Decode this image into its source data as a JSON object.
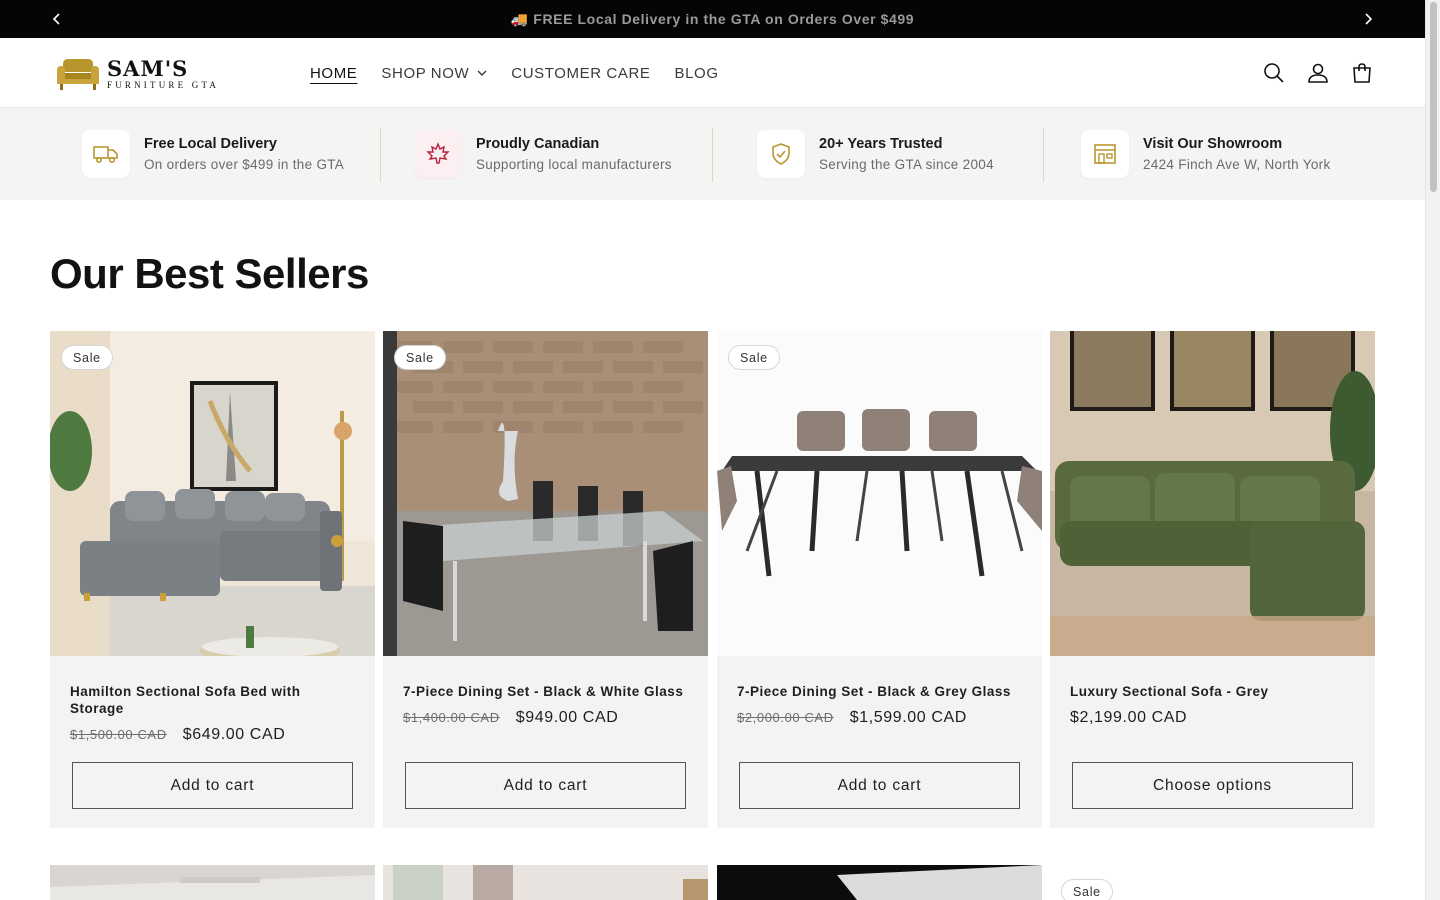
{
  "announcement": {
    "text": "🚚 FREE Local Delivery in the GTA on Orders Over $499"
  },
  "logo": {
    "name": "SAM'S",
    "tagline": "FURNITURE GTA"
  },
  "nav": {
    "home": "HOME",
    "shop": "SHOP NOW",
    "care": "CUSTOMER CARE",
    "blog": "BLOG"
  },
  "trust": [
    {
      "icon": "truck-icon",
      "title": "Free Local Delivery",
      "sub": "On orders over $499 in the GTA"
    },
    {
      "icon": "maple-leaf-icon",
      "title": "Proudly Canadian",
      "sub": "Supporting local manufacturers"
    },
    {
      "icon": "shield-check-icon",
      "title": "20+ Years Trusted",
      "sub": "Serving the GTA since 2004"
    },
    {
      "icon": "store-icon",
      "title": "Visit Our Showroom",
      "sub": "2424 Finch Ave W, North York"
    }
  ],
  "section": {
    "title": "Our Best Sellers"
  },
  "products": [
    {
      "badge": "Sale",
      "title": "Hamilton Sectional Sofa Bed with Storage",
      "old_price": "$1,500.00 CAD",
      "price": "$649.00 CAD",
      "button": "Add to cart"
    },
    {
      "badge": "Sale",
      "title": "7-Piece Dining Set - Black & White Glass",
      "old_price": "$1,400.00 CAD",
      "price": "$949.00 CAD",
      "button": "Add to cart"
    },
    {
      "badge": "Sale",
      "title": "7-Piece Dining Set - Black & Grey Glass",
      "old_price": "$2,000.00 CAD",
      "price": "$1,599.00 CAD",
      "button": "Add to cart"
    },
    {
      "badge": "",
      "title": "Luxury Sectional Sofa - Grey",
      "old_price": "",
      "price": "$2,199.00 CAD",
      "button": "Choose options"
    }
  ],
  "next_row": {
    "badge": "Sale"
  },
  "colors": {
    "accent": "#b8962e",
    "announce_bg": "#050505",
    "strip_bg": "#f4f4f2",
    "card_bg": "#f3f3f3"
  }
}
